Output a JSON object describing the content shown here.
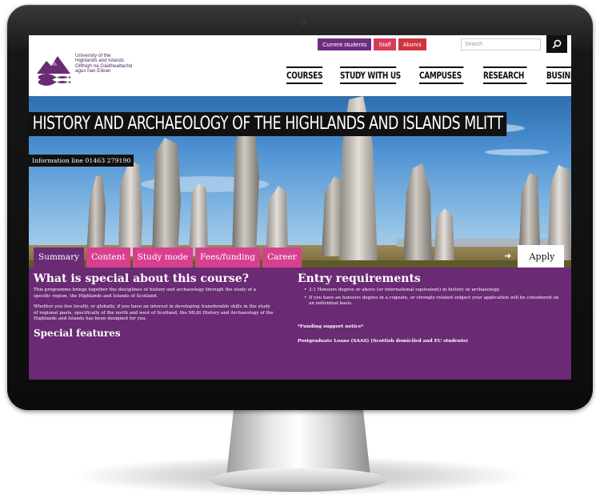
{
  "university": {
    "name_lines": [
      "University of the",
      "Highlands and Islands",
      "Oilthigh na Gàidhealtachd",
      "agus nan Eilean"
    ]
  },
  "top_links": {
    "students": "Current students",
    "staff": "Staff",
    "alumni": "Alumni"
  },
  "search": {
    "placeholder": "Search"
  },
  "main_nav": [
    "COURSES",
    "STUDY WITH US",
    "CAMPUSES",
    "RESEARCH",
    "BUSINESS"
  ],
  "hero": {
    "title": "HISTORY AND ARCHAEOLOGY OF THE HIGHLANDS AND ISLANDS MLITT",
    "info_line": "Information line 01463 279190"
  },
  "tabs": [
    "Summary",
    "Content",
    "Study mode",
    "Fees/funding",
    "Career"
  ],
  "apply_label": "Apply",
  "summary": {
    "heading": "What is special about this course?",
    "para1": "This programme brings together the disciplines of history and archaeology through the study of a specific region, the Highlands and Islands of Scotland.",
    "para2": "Whether you live locally, or globally, if you have an interest in developing transferable skills in the study of regional pasts, specifically of the north and west of Scotland, the MLitt History and Archaeology of the Highlands and Islands has been designed for you.",
    "features_heading": "Special features"
  },
  "entry": {
    "heading": "Entry requirements",
    "bullets": [
      "2:1 Honours degree or above (or international equivalent) in history or archaeology.",
      "If you have an honours degree in a cognate, or strongly-related subject your application will be considered on an individual basis."
    ],
    "funding_notice": "*Funding support notice*",
    "loans": "Postgraduate Loans (SAAS) (Scottish domiciled and EU students)"
  },
  "colors": {
    "purple": "#6a2a74",
    "pink_tab": "#d8408f",
    "staff_red": "#d83a5a",
    "alumni_red": "#d03440",
    "students_purple": "#6d2d7f"
  }
}
